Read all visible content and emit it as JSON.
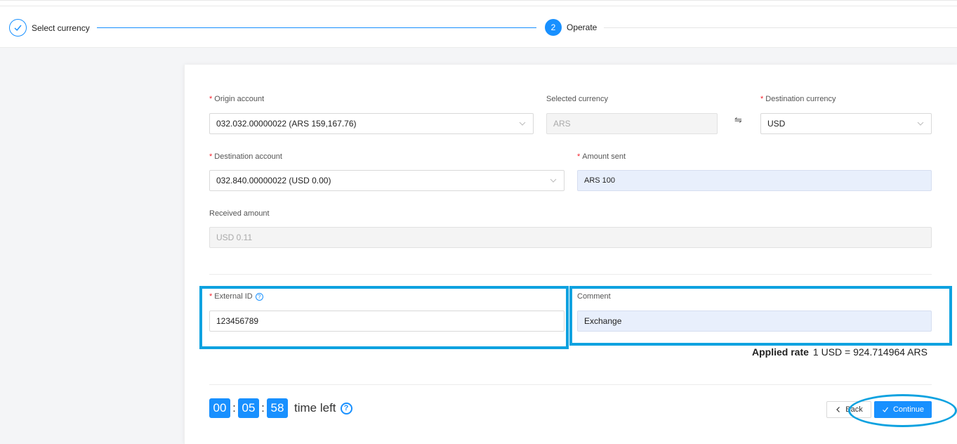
{
  "steps": [
    {
      "label": "Select currency",
      "status": "done"
    },
    {
      "label": "Operate",
      "number": "2",
      "status": "active"
    }
  ],
  "form": {
    "origin_account": {
      "label": "Origin account",
      "value": "032.032.00000022 (ARS 159,167.76)"
    },
    "selected_currency": {
      "label": "Selected currency",
      "value": "ARS"
    },
    "destination_currency": {
      "label": "Destination currency",
      "value": "USD"
    },
    "destination_account": {
      "label": "Destination account",
      "value": "032.840.00000022 (USD 0.00)"
    },
    "amount_sent": {
      "label": "Amount sent",
      "value": "ARS 100"
    },
    "received_amount": {
      "label": "Received amount",
      "value": "USD 0.11"
    },
    "external_id": {
      "label": "External ID",
      "value": "123456789"
    },
    "comment": {
      "label": "Comment",
      "value": "Exchange"
    }
  },
  "rate": {
    "label": "Applied rate",
    "value": "1 USD = 924.714964 ARS"
  },
  "timer": {
    "hours": "00",
    "minutes": "05",
    "seconds": "58",
    "label": "time left"
  },
  "buttons": {
    "back": "Back",
    "continue": "Continue"
  },
  "colors": {
    "accent": "#1890ff",
    "highlight": "#0ea2e0",
    "required": "#f5222d"
  }
}
